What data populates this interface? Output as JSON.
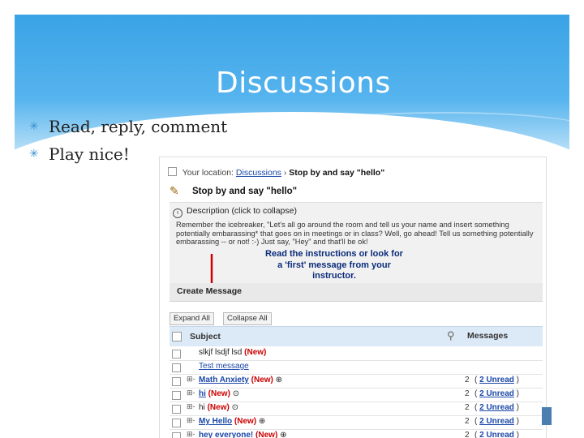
{
  "slide": {
    "title": "Discussions",
    "bullets": [
      "Read, reply, comment",
      "Play nice!"
    ]
  },
  "screenshot": {
    "location_label": "Your location:",
    "location_link": "Discussions",
    "location_sep": "›",
    "location_current": "Stop by and say \"hello\"",
    "topic_title": "Stop by and say \"hello\"",
    "description_label": "Description (click to collapse)",
    "description_text": "Remember the icebreaker, \"Let's all go around the room and tell us your name and insert something potentially embarassing* that goes on in meetings or in class? Well, go ahead! Tell us something potentially embarassing -- or not! :-) Just say, \"Hey\" and that'll be ok!",
    "callout": "Read the instructions or look for a 'first' message from your instructor.",
    "create_label": "Create Message",
    "expand_label": "Expand All",
    "collapse_label": "Collapse All",
    "col_subject": "Subject",
    "col_messages": "Messages",
    "new_tag": "(New)",
    "rows": [
      {
        "subject": "slkjf lsdjf lsd",
        "new": true,
        "count": "",
        "unread": ""
      },
      {
        "subject": "Test message",
        "new": false,
        "count": "",
        "unread": ""
      },
      {
        "subject": "Math Anxiety",
        "new": true,
        "count": "2",
        "unread": "2 Unread"
      },
      {
        "subject": "hi",
        "new": true,
        "count": "2",
        "unread": "2 Unread"
      },
      {
        "subject": "hi",
        "new": true,
        "count": "2",
        "unread": "2 Unread"
      },
      {
        "subject": "My Hello",
        "new": true,
        "count": "2",
        "unread": "2 Unread"
      },
      {
        "subject": "hey everyone!",
        "new": true,
        "count": "2",
        "unread": "2 Unread"
      }
    ]
  },
  "icons": [
    "star-bullet-icon",
    "topic-icon",
    "info-icon",
    "arrow-icon",
    "paperclip-icon",
    "expand-toggle-icon",
    "attachment-icon"
  ],
  "colors": {
    "band": "#3aa3e6",
    "link": "#1a47a8",
    "new": "#cc0000",
    "callout": "#0a2c7a",
    "arrow": "#cc0000"
  }
}
